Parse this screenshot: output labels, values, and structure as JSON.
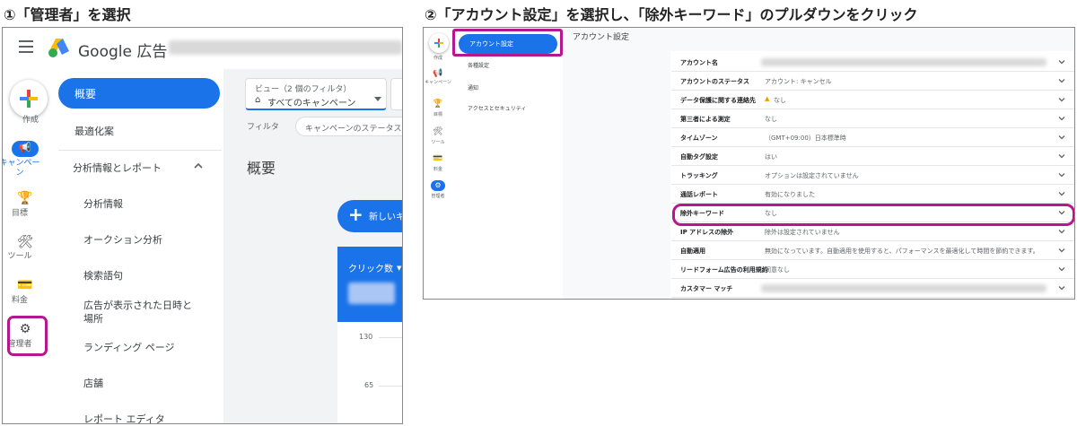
{
  "step1": {
    "title": "①「管理者」を選択",
    "brand": "Google 広告",
    "rail": {
      "create": "作成",
      "campaign": "キャンペーン",
      "goals": "目標",
      "tools": "ツール",
      "billing": "料金",
      "admin": "管理者"
    },
    "nav": {
      "overview": "概要",
      "recommendations": "最適化案",
      "insights_header": "分析情報とレポート",
      "items": [
        "分析情報",
        "オークション分析",
        "検索語句",
        "広告が表示された日時と場所",
        "ランディング ページ",
        "店舗",
        "レポート エディタ"
      ]
    },
    "view_label": "ビュー（2 個のフィルタ）",
    "view_value": "すべてのキャンペーン",
    "filter_label": "フィルタ",
    "filter_chip": "キャンペーンのステータス",
    "page_title": "概要",
    "new_button": "新しいキ",
    "clicks_label": "クリック数",
    "y_ticks": [
      "130",
      "65"
    ]
  },
  "step2": {
    "title": "②「アカウント設定」を選択し、「除外キーワード」のプルダウンをクリック",
    "rail": [
      "作成",
      "キャンペーン",
      "目標",
      "ツール",
      "料金",
      "管理者"
    ],
    "nav": [
      "アカウント設定",
      "各種設定",
      "通知",
      "アクセスとセキュリティ"
    ],
    "page_title": "アカウント設定",
    "rows": [
      {
        "key": "アカウント名",
        "value": ""
      },
      {
        "key": "アカウントのステータス",
        "value": "アカウント: キャンセル"
      },
      {
        "key": "データ保護に関する連絡先",
        "value": "なし"
      },
      {
        "key": "第三者による測定",
        "value": "なし"
      },
      {
        "key": "タイムゾーン",
        "value": "（GMT+09:00）日本標準時"
      },
      {
        "key": "自動タグ設定",
        "value": "はい"
      },
      {
        "key": "トラッキング",
        "value": "オプションは設定されていません"
      },
      {
        "key": "通話レポート",
        "value": "有効になりました"
      },
      {
        "key": "除外キーワード",
        "value": "なし"
      },
      {
        "key": "IP アドレスの除外",
        "value": "除外は設定されていません"
      },
      {
        "key": "自動適用",
        "value": "無効になっています。自動適用を使用すると、パフォーマンスを最適化して時間を節約できます。"
      },
      {
        "key": "リードフォーム広告の利用規約",
        "value": "同意なし"
      },
      {
        "key": "カスタマー マッチ",
        "value": ""
      }
    ]
  },
  "colors": {
    "accent": "#1a73e8",
    "highlight": "#b6168e"
  }
}
